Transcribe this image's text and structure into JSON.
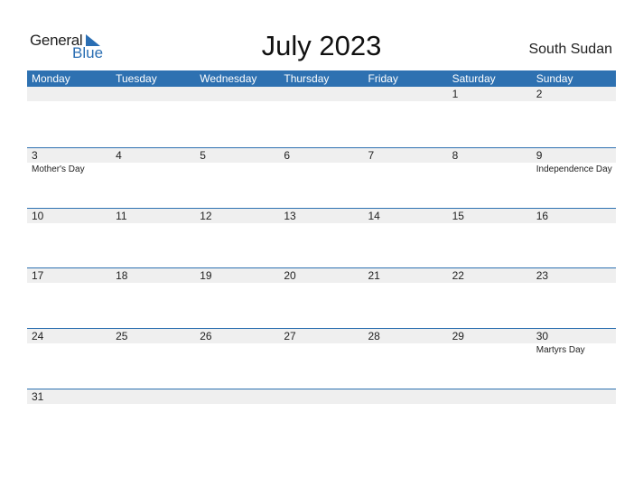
{
  "logo": {
    "general": "General",
    "blue": "Blue"
  },
  "title": "July 2023",
  "country": "South Sudan",
  "weekdays": [
    "Monday",
    "Tuesday",
    "Wednesday",
    "Thursday",
    "Friday",
    "Saturday",
    "Sunday"
  ],
  "weeks": [
    [
      {
        "num": ""
      },
      {
        "num": ""
      },
      {
        "num": ""
      },
      {
        "num": ""
      },
      {
        "num": ""
      },
      {
        "num": "1"
      },
      {
        "num": "2"
      }
    ],
    [
      {
        "num": "3",
        "holiday": "Mother's Day"
      },
      {
        "num": "4"
      },
      {
        "num": "5"
      },
      {
        "num": "6"
      },
      {
        "num": "7"
      },
      {
        "num": "8"
      },
      {
        "num": "9",
        "holiday": "Independence Day"
      }
    ],
    [
      {
        "num": "10"
      },
      {
        "num": "11"
      },
      {
        "num": "12"
      },
      {
        "num": "13"
      },
      {
        "num": "14"
      },
      {
        "num": "15"
      },
      {
        "num": "16"
      }
    ],
    [
      {
        "num": "17"
      },
      {
        "num": "18"
      },
      {
        "num": "19"
      },
      {
        "num": "20"
      },
      {
        "num": "21"
      },
      {
        "num": "22"
      },
      {
        "num": "23"
      }
    ],
    [
      {
        "num": "24"
      },
      {
        "num": "25"
      },
      {
        "num": "26"
      },
      {
        "num": "27"
      },
      {
        "num": "28"
      },
      {
        "num": "29"
      },
      {
        "num": "30",
        "holiday": "Martyrs Day"
      }
    ],
    [
      {
        "num": "31"
      },
      {
        "num": ""
      },
      {
        "num": ""
      },
      {
        "num": ""
      },
      {
        "num": ""
      },
      {
        "num": ""
      },
      {
        "num": ""
      }
    ]
  ],
  "colors": {
    "accent": "#2e71b1",
    "strip": "#efefef"
  }
}
